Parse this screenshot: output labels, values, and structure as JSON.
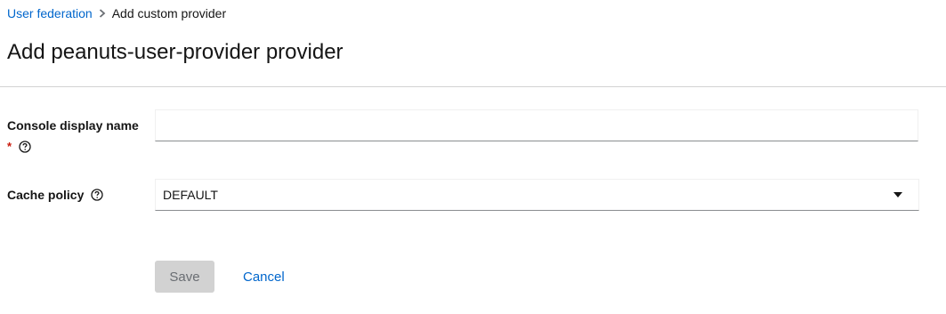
{
  "breadcrumb": {
    "parent": "User federation",
    "current": "Add custom provider"
  },
  "page": {
    "title": "Add peanuts-user-provider provider"
  },
  "form": {
    "display_name": {
      "label": "Console display name",
      "required_marker": "*",
      "value": ""
    },
    "cache_policy": {
      "label": "Cache policy",
      "selected": "DEFAULT"
    }
  },
  "actions": {
    "save_label": "Save",
    "cancel_label": "Cancel"
  },
  "colors": {
    "link": "#0066cc",
    "required": "#c9190b",
    "disabled_bg": "#d2d2d2"
  }
}
